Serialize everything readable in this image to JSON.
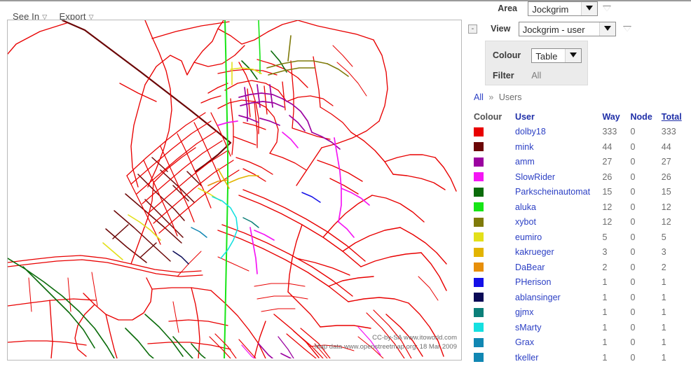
{
  "toolbar": {
    "see_in": "See In",
    "export": "Export",
    "dropdown_glyph": "▽"
  },
  "controls": {
    "area": {
      "label": "Area",
      "value": "Jockgrim"
    },
    "view": {
      "label": "View",
      "value": "Jockgrim - user",
      "collapse_label": "-"
    },
    "colour": {
      "label": "Colour",
      "value": "Table"
    },
    "filter": {
      "label": "Filter",
      "value": "All"
    }
  },
  "breadcrumb": {
    "root": "All",
    "separator": "»",
    "current": "Users"
  },
  "table": {
    "headers": {
      "colour": "Colour",
      "user": "User",
      "way": "Way",
      "node": "Node",
      "total": "Total"
    },
    "sorted_by": "Total",
    "rows": [
      {
        "colour": "#e80000",
        "user": "dolby18",
        "way": "333",
        "node": "0",
        "total": "333"
      },
      {
        "colour": "#6b0606",
        "user": "mink",
        "way": "44",
        "node": "0",
        "total": "44"
      },
      {
        "colour": "#9b02a0",
        "user": "amm",
        "way": "27",
        "node": "0",
        "total": "27"
      },
      {
        "colour": "#f416f4",
        "user": "SlowRider",
        "way": "26",
        "node": "0",
        "total": "26"
      },
      {
        "colour": "#0a6b0a",
        "user": "Parkscheinautomat",
        "way": "15",
        "node": "0",
        "total": "15"
      },
      {
        "colour": "#16e516",
        "user": "aluka",
        "way": "12",
        "node": "0",
        "total": "12"
      },
      {
        "colour": "#7f7a0a",
        "user": "xybot",
        "way": "12",
        "node": "0",
        "total": "12"
      },
      {
        "colour": "#e3e01a",
        "user": "eumiro",
        "way": "5",
        "node": "0",
        "total": "5"
      },
      {
        "colour": "#e2b400",
        "user": "kakrueger",
        "way": "3",
        "node": "0",
        "total": "3"
      },
      {
        "colour": "#e78f0a",
        "user": "DaBear",
        "way": "2",
        "node": "0",
        "total": "2"
      },
      {
        "colour": "#1410e8",
        "user": "PHerison",
        "way": "1",
        "node": "0",
        "total": "1"
      },
      {
        "colour": "#0a0a56",
        "user": "ablansinger",
        "way": "1",
        "node": "0",
        "total": "1"
      },
      {
        "colour": "#0b7f79",
        "user": "gjmx",
        "way": "1",
        "node": "0",
        "total": "1"
      },
      {
        "colour": "#15e0e0",
        "user": "sMarty",
        "way": "1",
        "node": "0",
        "total": "1"
      },
      {
        "colour": "#1187b3",
        "user": "Grax",
        "way": "1",
        "node": "0",
        "total": "1"
      },
      {
        "colour": "#1187b3",
        "user": "tkeller",
        "way": "1",
        "node": "0",
        "total": "1"
      }
    ]
  },
  "map": {
    "attribution_line1": "CC-by-SA www.itoworld.com",
    "attribution_line2": "Map data www.openstreetmap.org: 18 Mar 2009"
  }
}
